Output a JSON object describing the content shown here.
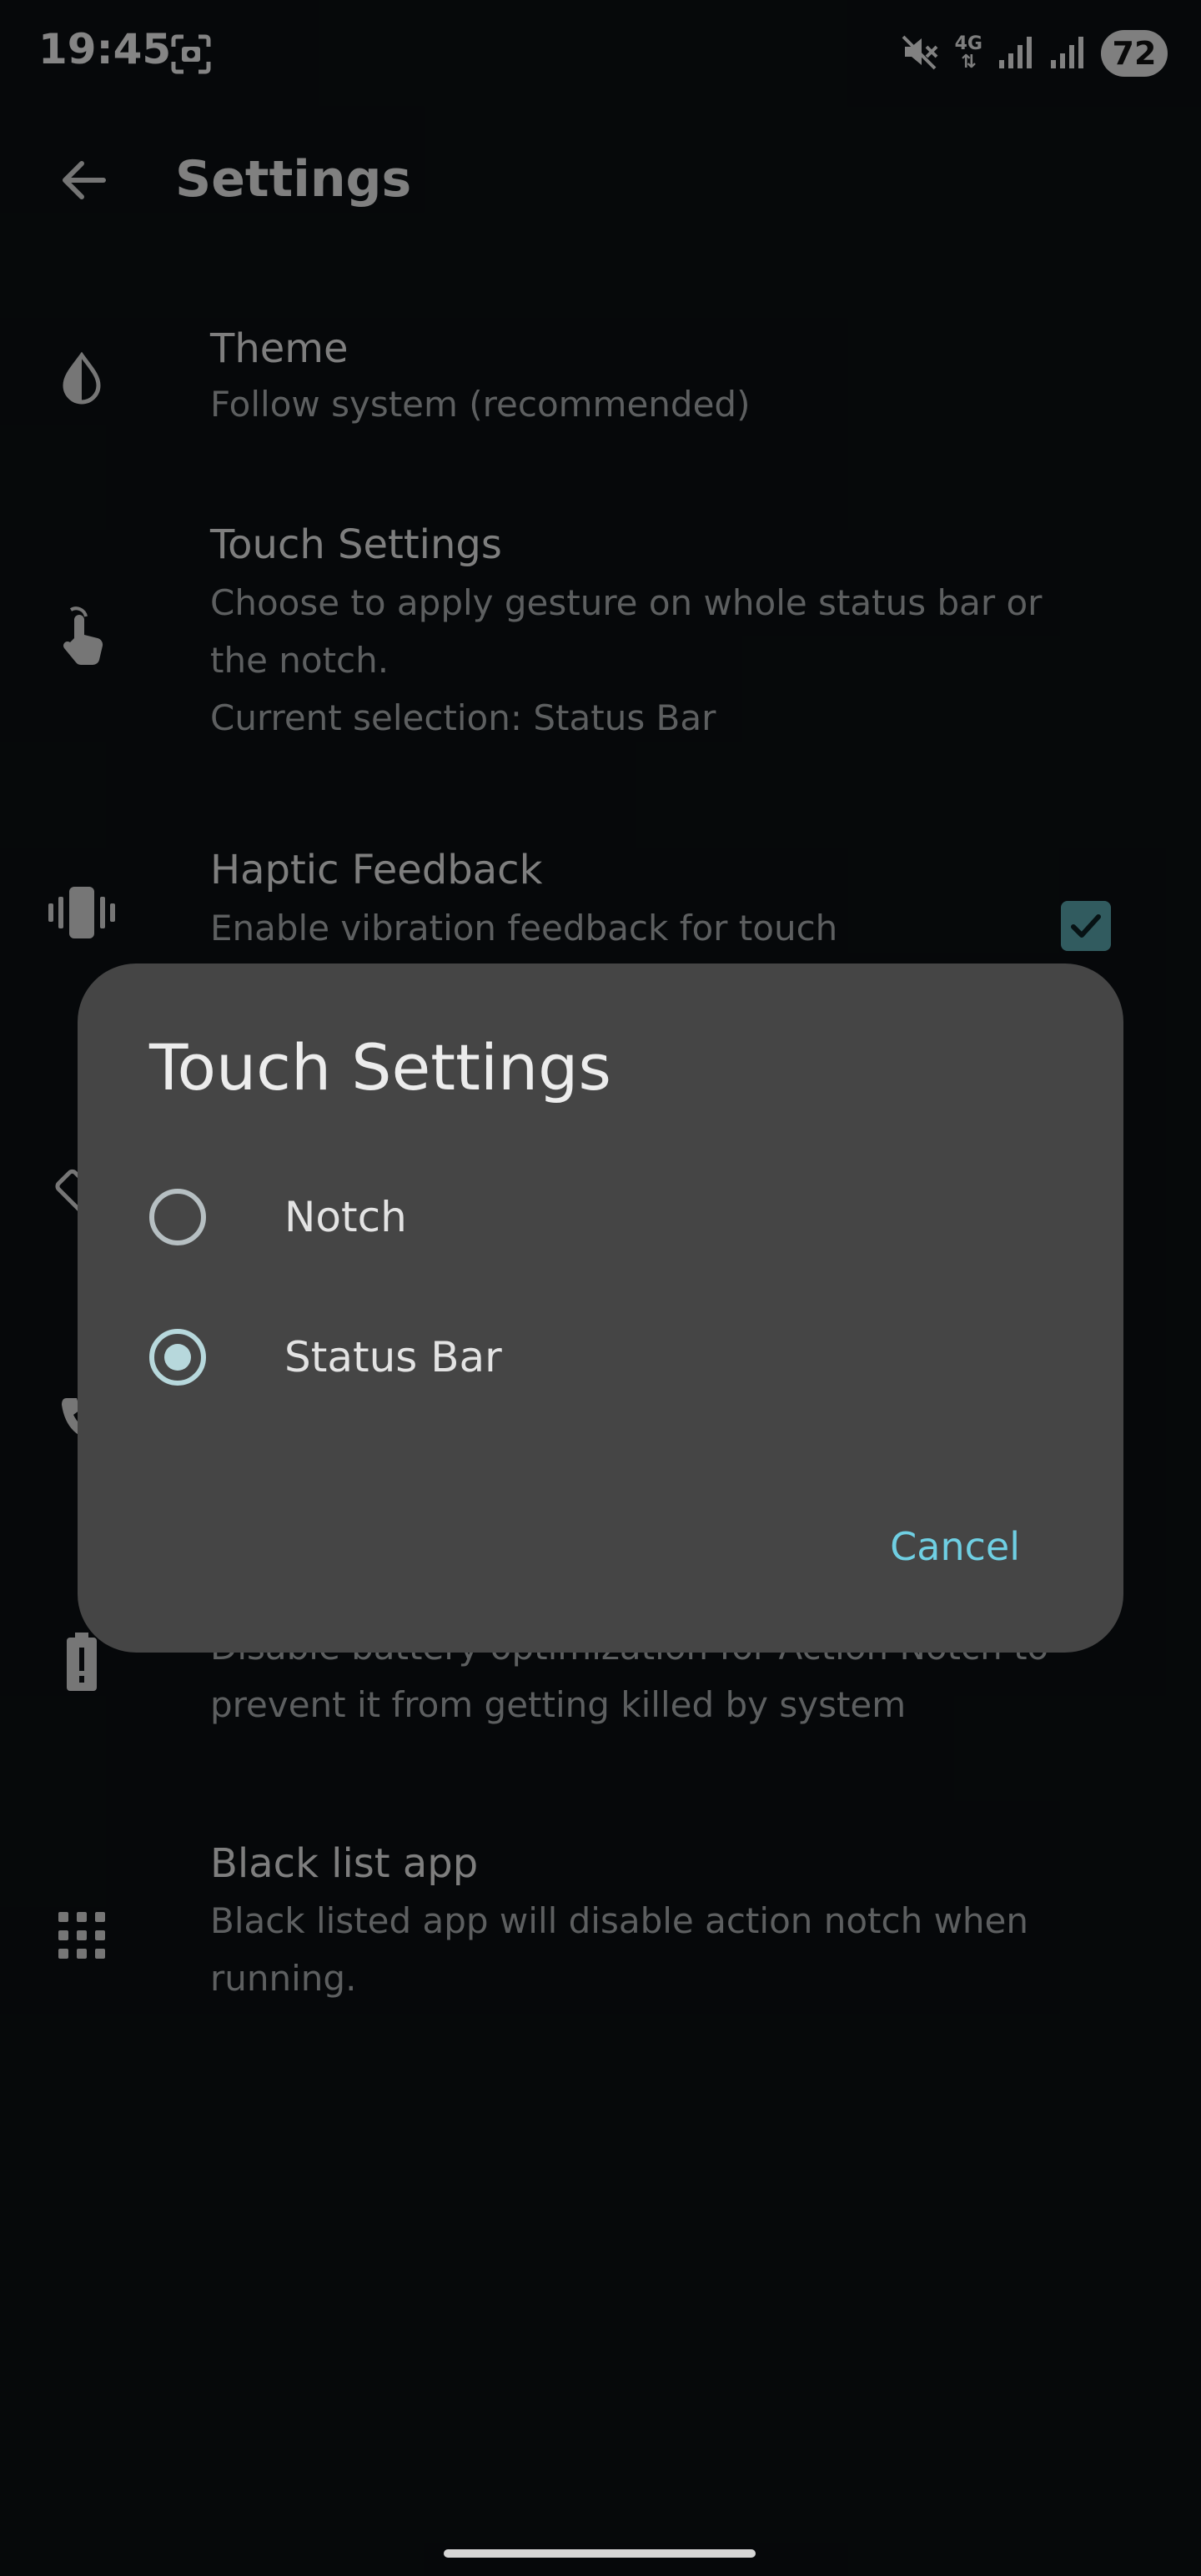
{
  "status_bar": {
    "time": "19:45",
    "network": "4G",
    "battery": "72",
    "icons": [
      "screenshot-icon",
      "mute-icon",
      "signal-icon",
      "battery-icon"
    ]
  },
  "app_bar": {
    "title": "Settings",
    "back_icon": "arrow-back-icon"
  },
  "settings": [
    {
      "icon": "theme-icon",
      "title": "Theme",
      "subtitle": "Follow system (recommended)"
    },
    {
      "icon": "touch-icon",
      "title": "Touch Settings",
      "subtitle_lines": [
        "Choose to apply gesture on whole status bar or",
        "the notch.",
        "Current selection: Status Bar"
      ]
    },
    {
      "icon": "vibration-icon",
      "title": "Haptic Feedback",
      "subtitle": "Enable vibration feedback for touch",
      "checked": true
    },
    {
      "icon": "battery-alert-icon",
      "subtitle_lines": [
        "Disable battery optimization for Action Notch to",
        "prevent it from getting killed by system"
      ]
    },
    {
      "icon": "apps-grid-icon",
      "title": "Black list app",
      "subtitle_lines": [
        "Black listed app will disable action notch when",
        "running."
      ]
    }
  ],
  "dialog": {
    "title": "Touch Settings",
    "options": [
      {
        "label": "Notch",
        "selected": false
      },
      {
        "label": "Status Bar",
        "selected": true
      }
    ],
    "cancel_label": "Cancel"
  },
  "colors": {
    "background": "#0b1013",
    "dialog": "#454545",
    "accent": "#6fcfe3",
    "checkbox": "#5aa7ad"
  }
}
